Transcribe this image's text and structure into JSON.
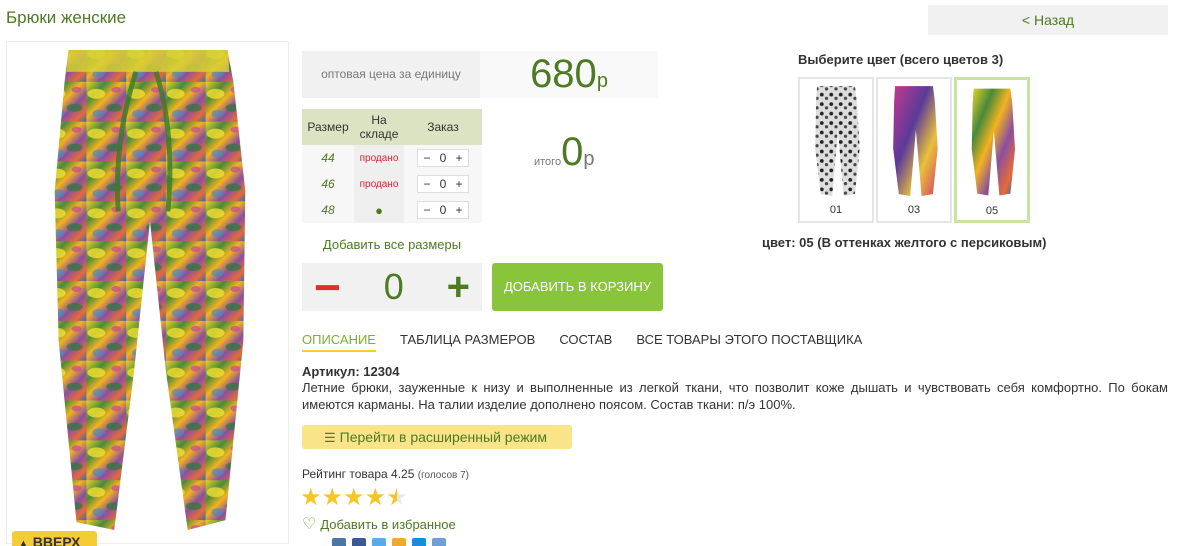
{
  "header": {
    "title": "Брюки женские",
    "back_label": "< Назад"
  },
  "price": {
    "label": "оптовая цена за единицу",
    "value": "680",
    "unit": "р"
  },
  "size_table": {
    "headers": [
      "Размер",
      "На складе",
      "Заказ"
    ],
    "rows": [
      {
        "size": "44",
        "stock": "продано",
        "qty": "0"
      },
      {
        "size": "46",
        "stock": "продано",
        "qty": "0"
      },
      {
        "size": "48",
        "stock": "●",
        "qty": "0"
      }
    ]
  },
  "total": {
    "label": "итого",
    "value": "0",
    "unit": "р"
  },
  "add_all_sizes": "Добавить все размеры",
  "quantity": {
    "value": "0",
    "minus": "−",
    "plus": "+"
  },
  "cart_button": "ДОБАВИТЬ В КОРЗИНУ",
  "colors": {
    "title": "Выберите цвет (всего цветов 3)",
    "swatches": [
      {
        "code": "01",
        "selected": false
      },
      {
        "code": "03",
        "selected": false
      },
      {
        "code": "05",
        "selected": true
      }
    ],
    "current": "цвет: 05 (В оттенках желтого с персиковым)"
  },
  "tabs": [
    "ОПИСАНИЕ",
    "ТАБЛИЦА РАЗМЕРОВ",
    "СОСТАВ",
    "ВСЕ ТОВАРЫ ЭТОГО ПОСТАВЩИКА"
  ],
  "description": {
    "article": "Артикул: 12304",
    "text": "Летние брюки, зауженные к низу и выполненные из легкой ткани, что позволит коже дышать и чувствовать себя комфортно. По бокам имеются карманы. На талии изделие дополнено поясом. Состав ткани: п/э 100%."
  },
  "extended_mode": "Перейти в расширенный режим",
  "rating": {
    "label": "Рейтинг товара 4.25",
    "votes": "(голосов 7)",
    "value": 4.25,
    "max": 5
  },
  "favorite": "Добавить в избранное",
  "up_button": "ВВЕРХ",
  "colors_accent": {
    "green": "#4d7a22",
    "light_green": "#89c53a",
    "yellow": "#f6cc35"
  }
}
